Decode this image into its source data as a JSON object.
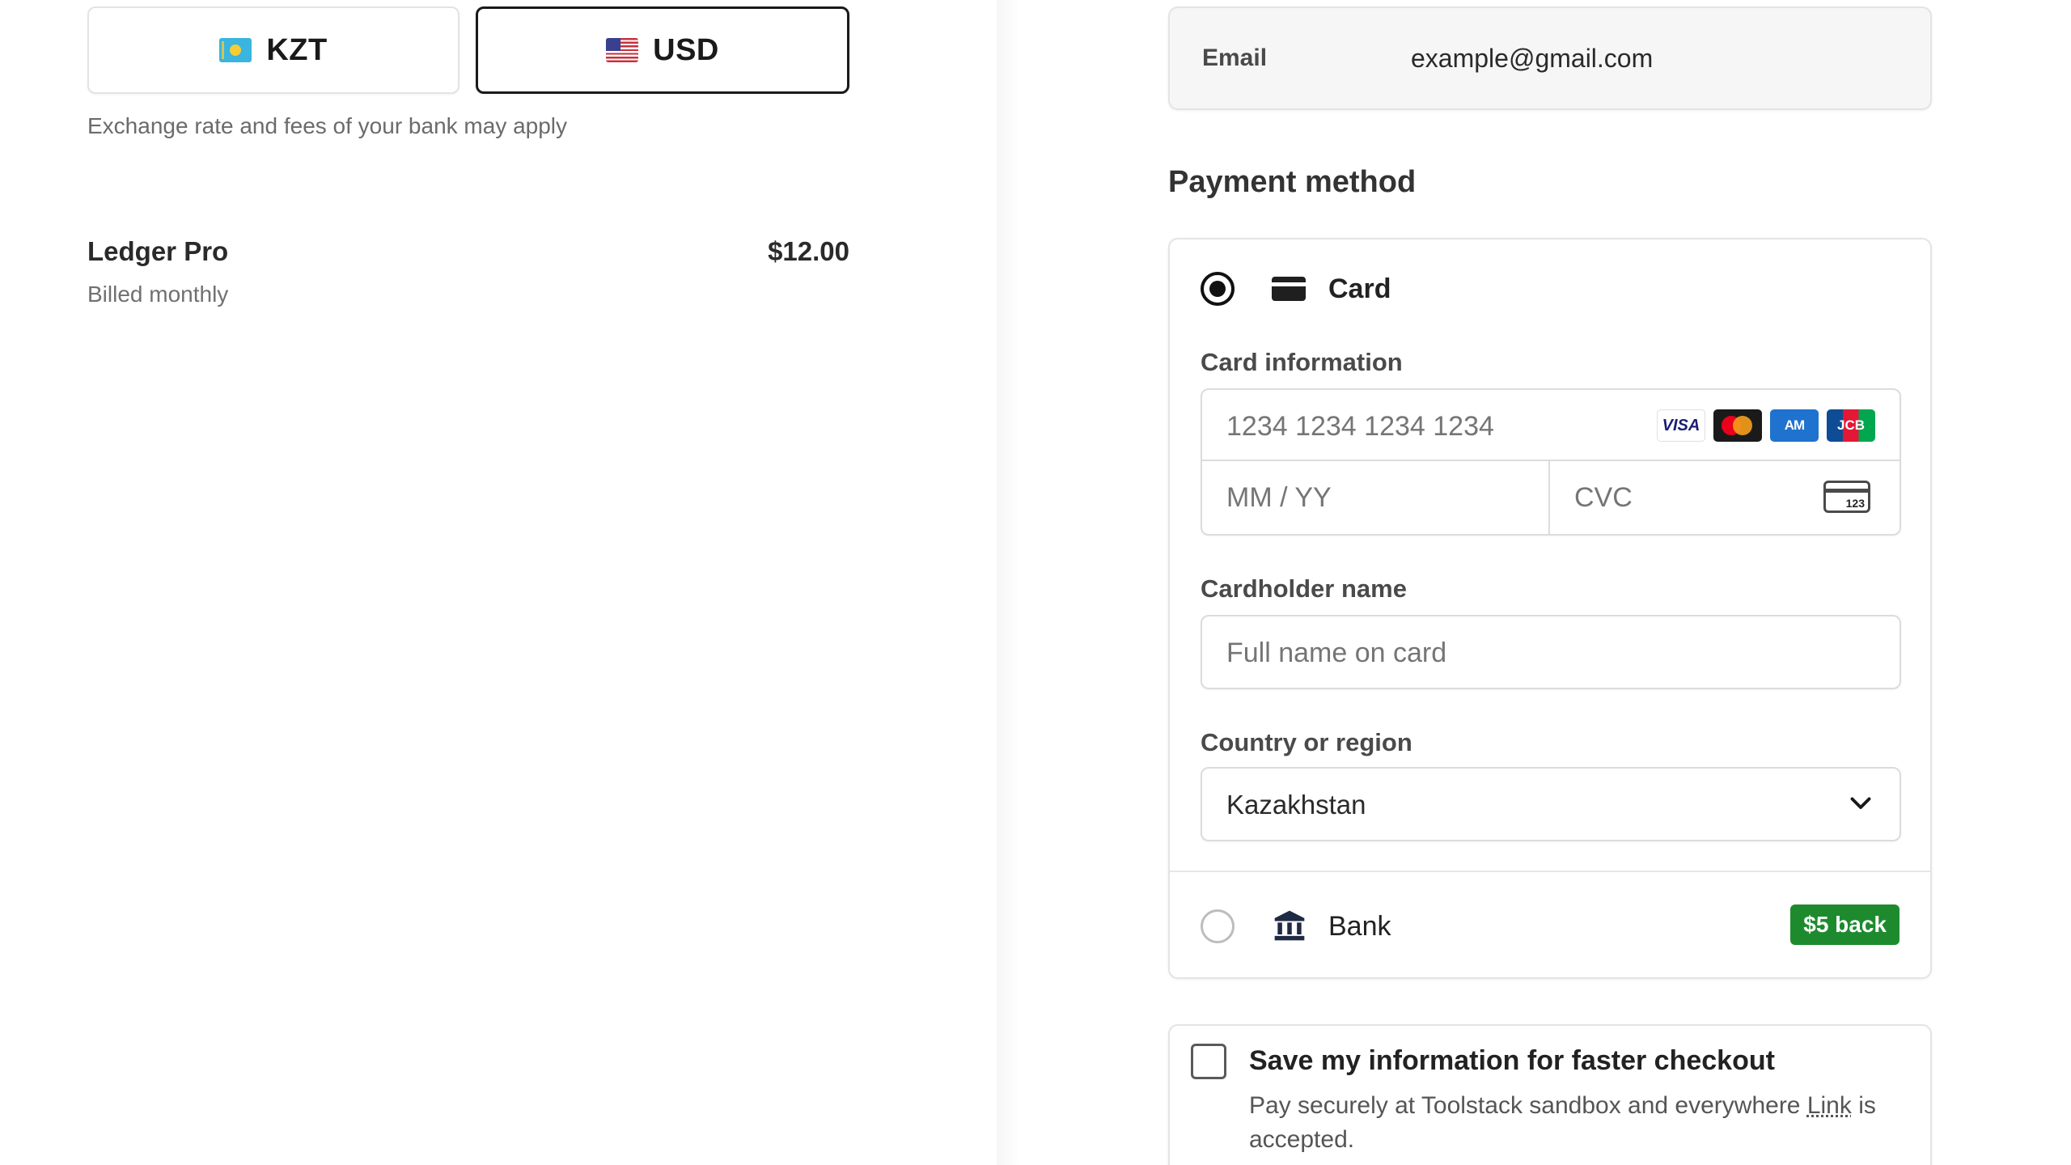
{
  "currency": {
    "options": [
      {
        "code": "KZT",
        "flag": "kazakhstan-flag",
        "selected": false
      },
      {
        "code": "USD",
        "flag": "usa-flag",
        "selected": true
      }
    ],
    "note": "Exchange rate and fees of your bank may apply"
  },
  "order": {
    "item_name": "Ledger Pro",
    "item_price": "$12.00",
    "billing_period": "Billed monthly"
  },
  "contact": {
    "email_label": "Email",
    "email_value": "example@gmail.com"
  },
  "payment": {
    "title": "Payment method",
    "card_option": {
      "label": "Card",
      "selected": true,
      "icon": "credit-card-icon"
    },
    "card_info_label": "Card information",
    "card_number_placeholder": "1234 1234 1234 1234",
    "brands": [
      "VISA",
      "Mastercard",
      "AMEX",
      "JCB"
    ],
    "brand_text": {
      "visa": "VISA",
      "amex": "AM",
      "jcb": "JCB"
    },
    "expiry_placeholder": "MM / YY",
    "cvc_placeholder": "CVC",
    "cvc_icon_text": "123",
    "cardholder_label": "Cardholder name",
    "cardholder_placeholder": "Full name on card",
    "country_label": "Country or region",
    "country_value": "Kazakhstan",
    "bank_option": {
      "label": "Bank",
      "selected": false,
      "icon": "bank-icon",
      "badge": "$5 back"
    }
  },
  "save_info": {
    "checked": false,
    "title": "Save my information for faster checkout",
    "desc_before": "Pay securely at Toolstack sandbox and everywhere ",
    "link_text": "Link",
    "desc_after": " is accepted."
  },
  "colors": {
    "badge_green": "#1e8a2e",
    "selected_border": "#1a1a1a",
    "border": "#e4e4e4"
  }
}
